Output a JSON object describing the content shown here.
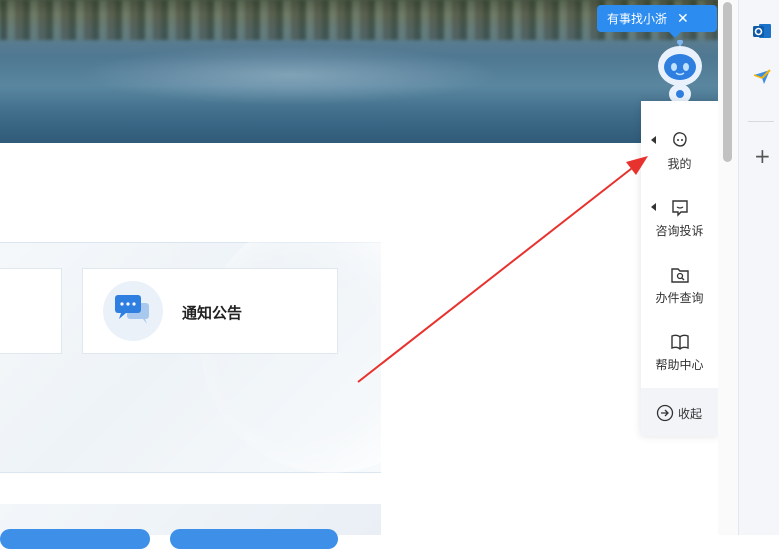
{
  "banner": {
    "image": "lake-landscape-photo"
  },
  "cards": {
    "notice": {
      "label": "通知公告",
      "icon": "chat-bubbles-icon"
    }
  },
  "assistant": {
    "bubble_text": "有事找小浙",
    "close_symbol": "✕"
  },
  "side_menu": {
    "items": [
      {
        "label": "我的",
        "icon": "face-icon",
        "has_caret": true
      },
      {
        "label": "咨询投诉",
        "icon": "message-icon",
        "has_caret": true
      },
      {
        "label": "办件查询",
        "icon": "folder-search-icon",
        "has_caret": false
      },
      {
        "label": "帮助中心",
        "icon": "book-icon",
        "has_caret": false
      }
    ],
    "collapse_label": "收起"
  },
  "browser_sidebar": {
    "apps": [
      "outlook-icon",
      "send-icon"
    ],
    "add_symbol": "+"
  },
  "colors": {
    "accent": "#2d8cf0",
    "annotation_arrow": "#e8322e",
    "pill_blue": "#3d8fe8"
  }
}
